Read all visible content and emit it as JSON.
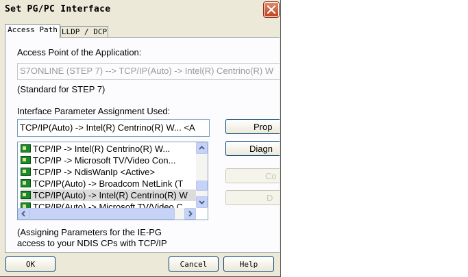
{
  "window": {
    "title": "Set PG/PC Interface"
  },
  "tabs": [
    {
      "label": "Access Path"
    },
    {
      "label": "LLDP / DCP"
    }
  ],
  "access_point": {
    "label": "Access Point of the Application:",
    "value": "S7ONLINE      (STEP 7)      --> TCP/IP(Auto) -> Intel(R) Centrino(R) W",
    "note": "(Standard for STEP 7)"
  },
  "interface": {
    "label": "Interface Parameter Assignment Used:",
    "value": "TCP/IP(Auto) -> Intel(R) Centrino(R) W...  <A",
    "list": [
      "TCP/IP -> Intel(R) Centrino(R) W...",
      "TCP/IP -> Microsoft TV/Video Con...",
      "TCP/IP -> NdisWanIp   <Active>",
      "TCP/IP(Auto) -> Broadcom NetLink (T",
      "TCP/IP(Auto) -> Intel(R) Centrino(R) W",
      "TCP/IP(Auto) -> Microsoft TV/Video C"
    ]
  },
  "side_buttons": {
    "properties": "Prop",
    "diagnostics": "Diagn",
    "copy": "Co",
    "delete": "D"
  },
  "info": {
    "line1": "(Assigning Parameters for the IE-PG",
    "line2": "access to your NDIS CPs with TCP/IP"
  },
  "buttons": {
    "ok": "OK",
    "cancel": "Cancel",
    "help": "Help"
  }
}
